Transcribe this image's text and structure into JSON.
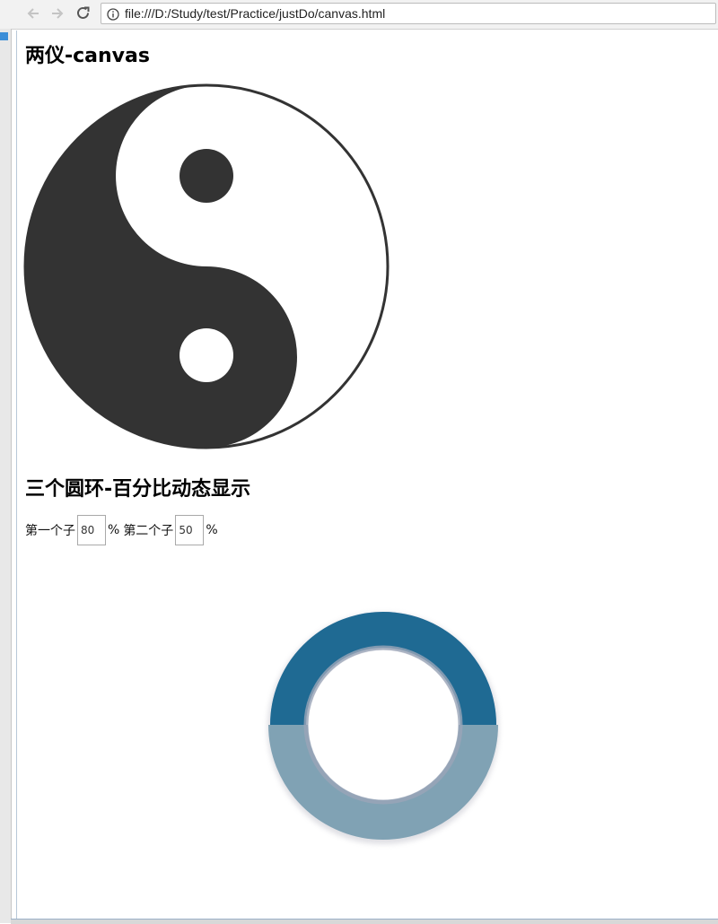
{
  "browser": {
    "url": "file:///D:/Study/test/Practice/justDo/canvas.html",
    "icons": [
      "back-arrow-icon",
      "forward-arrow-icon",
      "reload-icon",
      "info-icon"
    ]
  },
  "page": {
    "title": "两仪-canvas",
    "subtitle": "三个圆环-百分比动态显示"
  },
  "controls": {
    "first_label": "第一个子",
    "first_value": "80",
    "percent_sign": "%",
    "second_label": "第二个子",
    "second_value": "50"
  },
  "colors": {
    "taiji_dark": "#333333",
    "taiji_light": "#ffffff",
    "ring_dark": "#1f6a93",
    "ring_light": "#b1b8d8",
    "ring_half": "#80a2b4"
  },
  "rings": {
    "first_percent": 80,
    "second_percent": 50
  }
}
